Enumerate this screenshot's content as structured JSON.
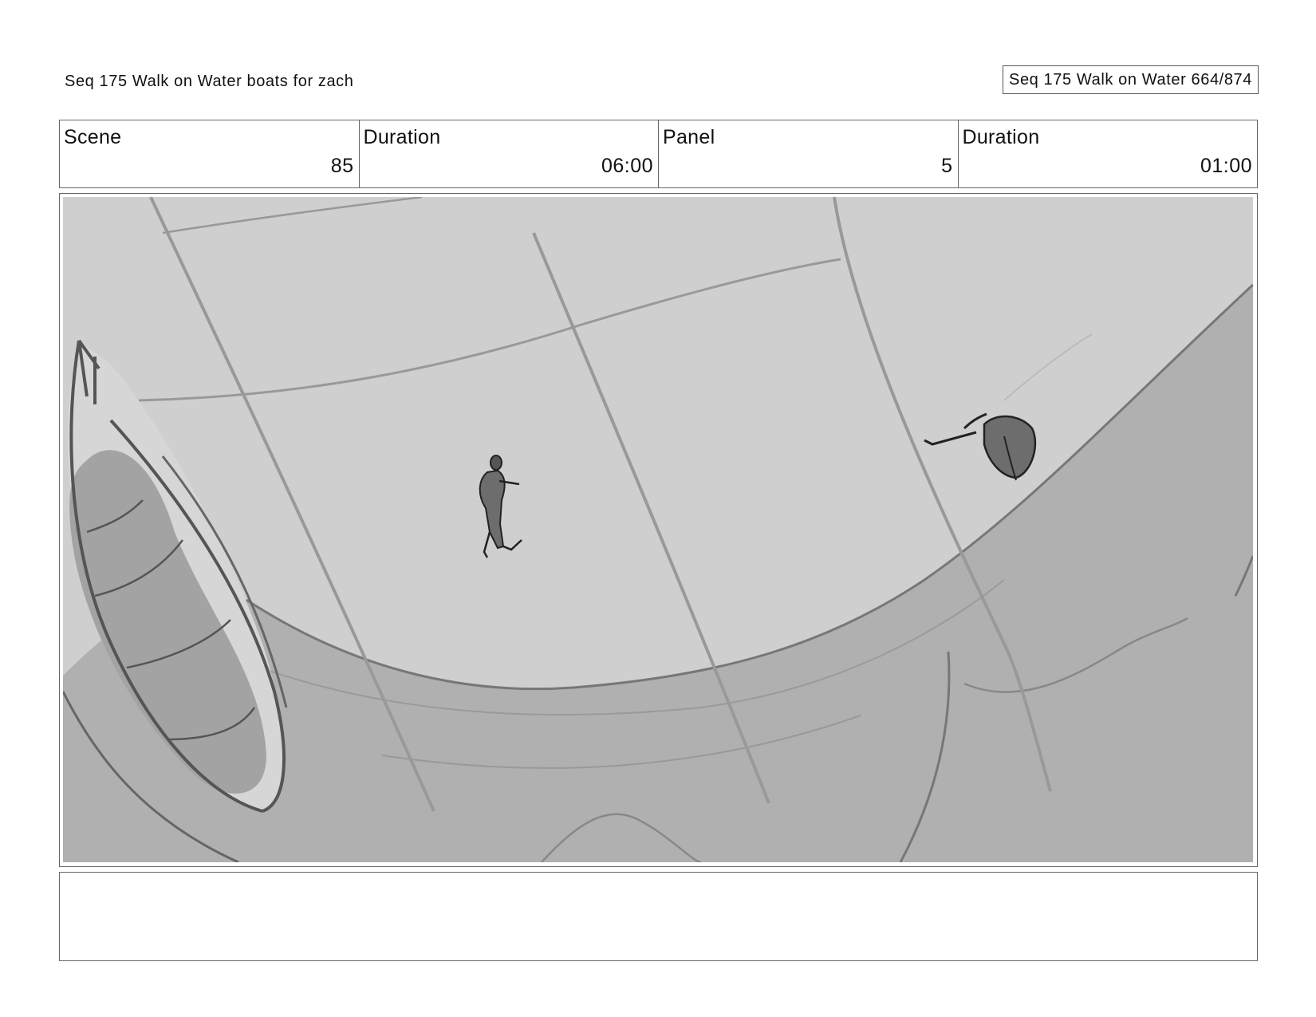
{
  "header": {
    "title": "Seq 175 Walk on Water  boats for zach",
    "page_label": "Seq 175 Walk on Water 664/874"
  },
  "info": [
    {
      "label": "Scene",
      "value": "85"
    },
    {
      "label": "Duration",
      "value": "06:00"
    },
    {
      "label": "Panel",
      "value": "5"
    },
    {
      "label": "Duration",
      "value": "01:00"
    }
  ],
  "notes": {
    "text": ""
  }
}
